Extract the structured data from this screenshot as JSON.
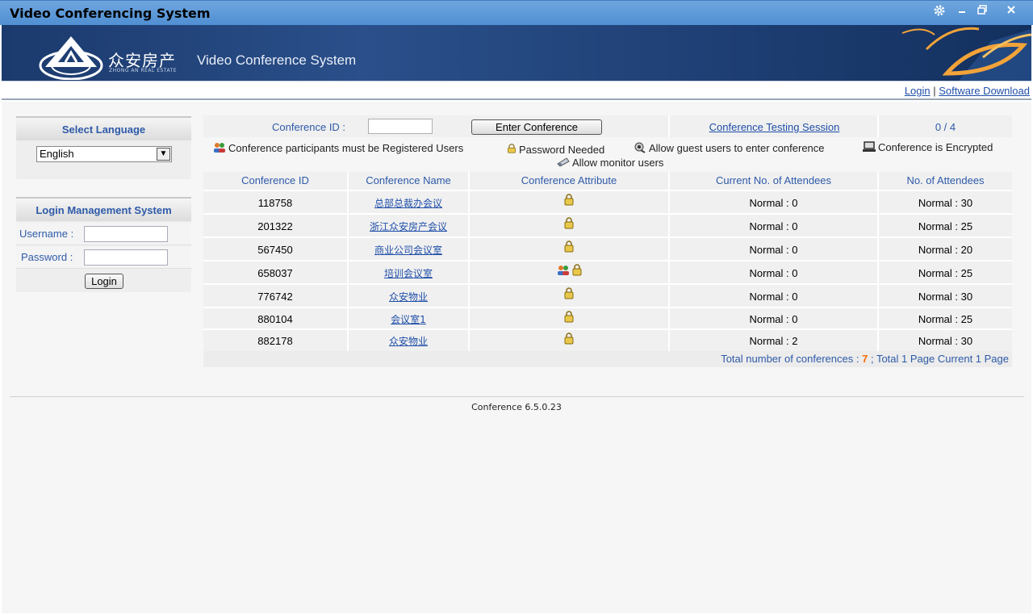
{
  "window": {
    "title": "Video Conferencing System",
    "controls": [
      "gear-icon",
      "minimize-icon",
      "restore-icon",
      "close-icon"
    ]
  },
  "banner": {
    "brand_cn": "众安房产",
    "brand_en": "ZHONG AN REAL ESTATE",
    "system_name": "Video Conference System"
  },
  "nav": {
    "login": "Login",
    "separator": "|",
    "software_download": "Software Download"
  },
  "language": {
    "heading": "Select Language",
    "selected": "English"
  },
  "login": {
    "heading": "Login Management System",
    "username_label": "Username :",
    "password_label": "Password :",
    "button": "Login"
  },
  "toolbar": {
    "conference_id_label": "Conference ID :",
    "enter_button": "Enter Conference",
    "testing_session": "Conference Testing Session",
    "session_count": "0 / 4"
  },
  "legend": {
    "registered": "Conference participants must be Registered Users",
    "password": "Password Needed",
    "guest": "Allow guest users to enter conference",
    "encrypted": "Conference is Encrypted",
    "monitor": "Allow monitor users"
  },
  "table": {
    "headers": [
      "Conference ID",
      "Conference Name",
      "Conference Attribute",
      "Current No. of Attendees",
      "No. of Attendees"
    ],
    "rows": [
      {
        "id": "118758",
        "name": "总部总裁办会议",
        "attrs": [
          "lock"
        ],
        "current": "Normal : 0",
        "total": "Normal : 30"
      },
      {
        "id": "201322",
        "name": "浙江众安房产会议",
        "attrs": [
          "lock"
        ],
        "current": "Normal : 0",
        "total": "Normal : 25"
      },
      {
        "id": "567450",
        "name": "商业公司会议室",
        "attrs": [
          "lock"
        ],
        "current": "Normal : 0",
        "total": "Normal : 20"
      },
      {
        "id": "658037",
        "name": "培训会议室",
        "attrs": [
          "users",
          "lock"
        ],
        "current": "Normal : 0",
        "total": "Normal : 25"
      },
      {
        "id": "776742",
        "name": "众安物业",
        "attrs": [
          "lock"
        ],
        "current": "Normal : 0",
        "total": "Normal : 30"
      },
      {
        "id": "880104",
        "name": "会议室1",
        "attrs": [
          "lock"
        ],
        "current": "Normal : 0",
        "total": "Normal : 25"
      },
      {
        "id": "882178",
        "name": "众安物业",
        "attrs": [
          "lock"
        ],
        "current": "Normal : 2",
        "total": "Normal : 30"
      }
    ],
    "summary_prefix": "Total number of conferences :",
    "total_count": "7",
    "summary_suffix": "; Total 1 Page Current 1 Page"
  },
  "footer": {
    "version": "Conference 6.5.0.23"
  },
  "colors": {
    "titlebar": "#5b99d8",
    "banner": "#1e3f74",
    "accent_text": "#2e5aa8",
    "link": "#1f4ea8",
    "highlight": "#ff6a00"
  }
}
